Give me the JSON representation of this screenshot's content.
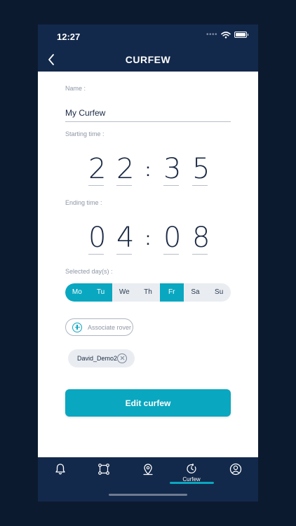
{
  "status_bar": {
    "time": "12:27",
    "signal_icon": "signal-dots-icon",
    "wifi_icon": "wifi-icon",
    "battery_icon": "battery-icon"
  },
  "header": {
    "title": "CURFEW",
    "back_icon": "chevron-left-icon"
  },
  "form": {
    "name_label": "Name :",
    "name_value": "My Curfew",
    "start_label": "Starting time :",
    "start_digits": [
      "2",
      "2",
      "3",
      "5"
    ],
    "end_label": "Ending time :",
    "end_digits": [
      "0",
      "4",
      "0",
      "8"
    ],
    "colon": ":",
    "days_label": "Selected day(s) :",
    "days": [
      {
        "label": "Mo",
        "selected": true
      },
      {
        "label": "Tu",
        "selected": true
      },
      {
        "label": "We",
        "selected": false
      },
      {
        "label": "Th",
        "selected": false
      },
      {
        "label": "Fr",
        "selected": true
      },
      {
        "label": "Sa",
        "selected": false
      },
      {
        "label": "Su",
        "selected": false
      }
    ],
    "associate_label": "Associate rover",
    "rover_chip": "David_Demo2",
    "edit_label": "Edit curfew"
  },
  "tabbar": {
    "tabs": [
      {
        "icon": "bell-icon",
        "label": ""
      },
      {
        "icon": "geofence-icon",
        "label": ""
      },
      {
        "icon": "map-pin-icon",
        "label": ""
      },
      {
        "icon": "curfew-clock-icon",
        "label": "Curfew",
        "active": true
      },
      {
        "icon": "profile-icon",
        "label": ""
      }
    ]
  },
  "colors": {
    "accent": "#0aa7c0",
    "navy": "#13294b",
    "background": "#0c1a2f"
  }
}
